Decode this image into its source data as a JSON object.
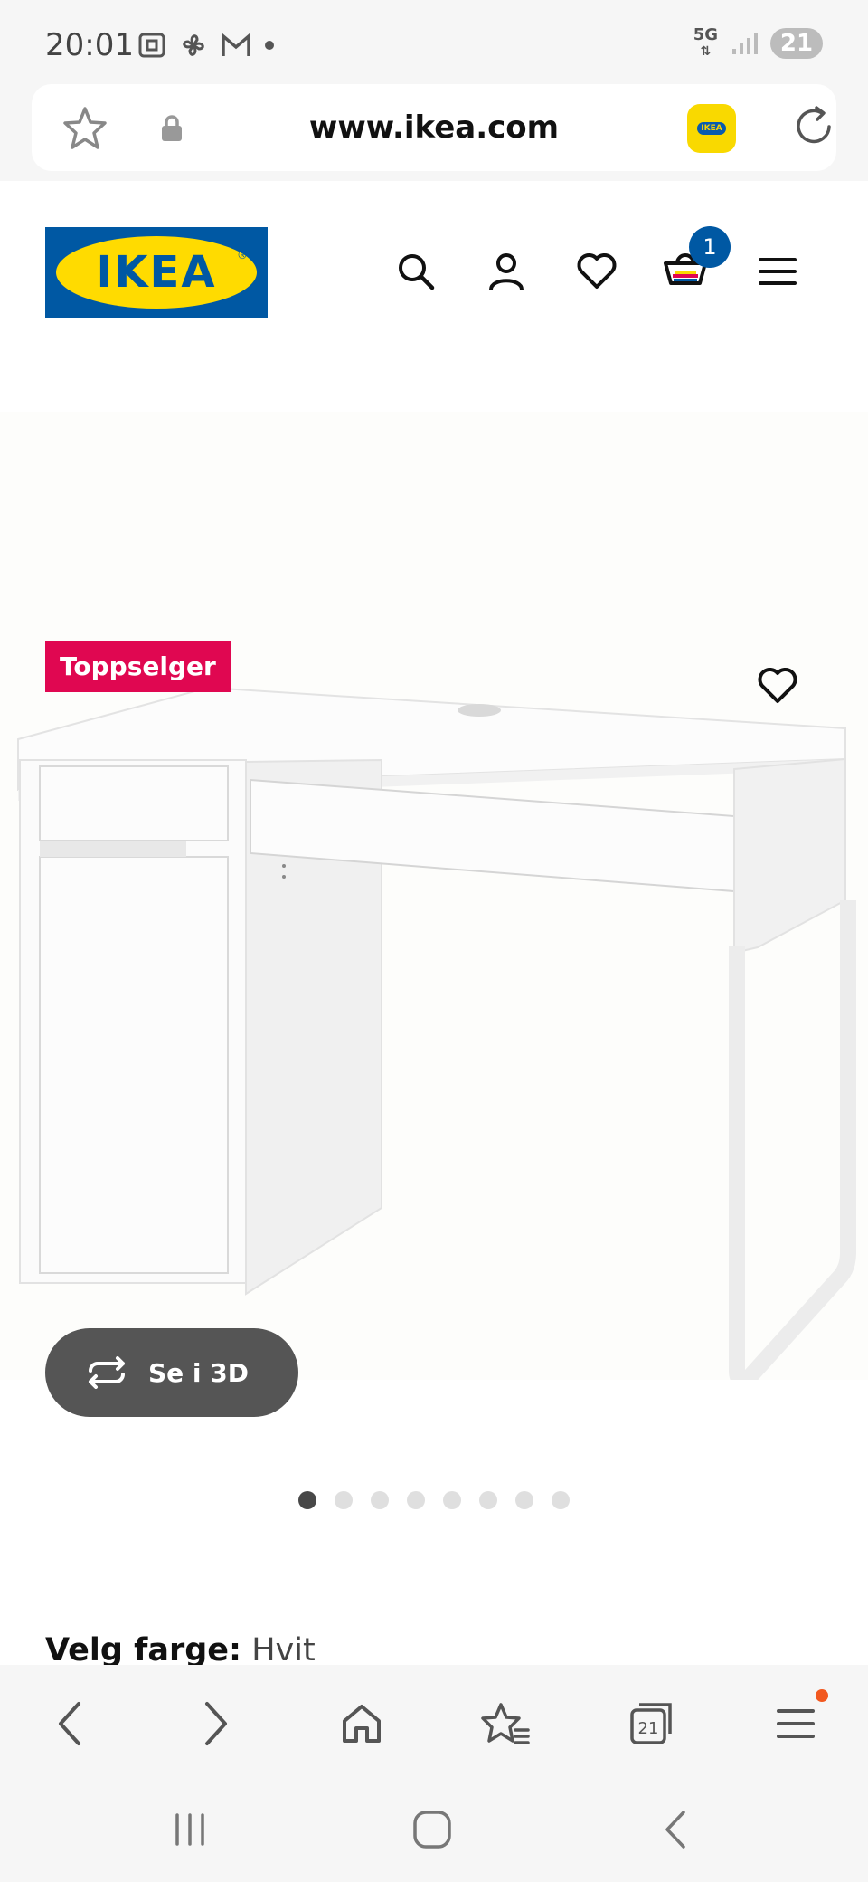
{
  "status_bar": {
    "time": "20:01",
    "network": "5G",
    "battery": "21"
  },
  "browser": {
    "url": "www.ikea.com",
    "tabs_count": "21"
  },
  "header": {
    "logo_text": "IKEA",
    "cart_count": "1"
  },
  "product": {
    "badge": "Toppselger",
    "view_3d_label": "Se i 3D",
    "image_count": 8,
    "active_image": 1,
    "color_label": "Velg farge:",
    "color_value": "Hvit",
    "swatches": [
      "black-red",
      "black-brown",
      "white",
      "white-birch"
    ],
    "selected_swatch": 3
  },
  "colors": {
    "accent_yellow": "#fad900",
    "ikea_blue": "#0058a3",
    "badge_red": "#e00751"
  }
}
